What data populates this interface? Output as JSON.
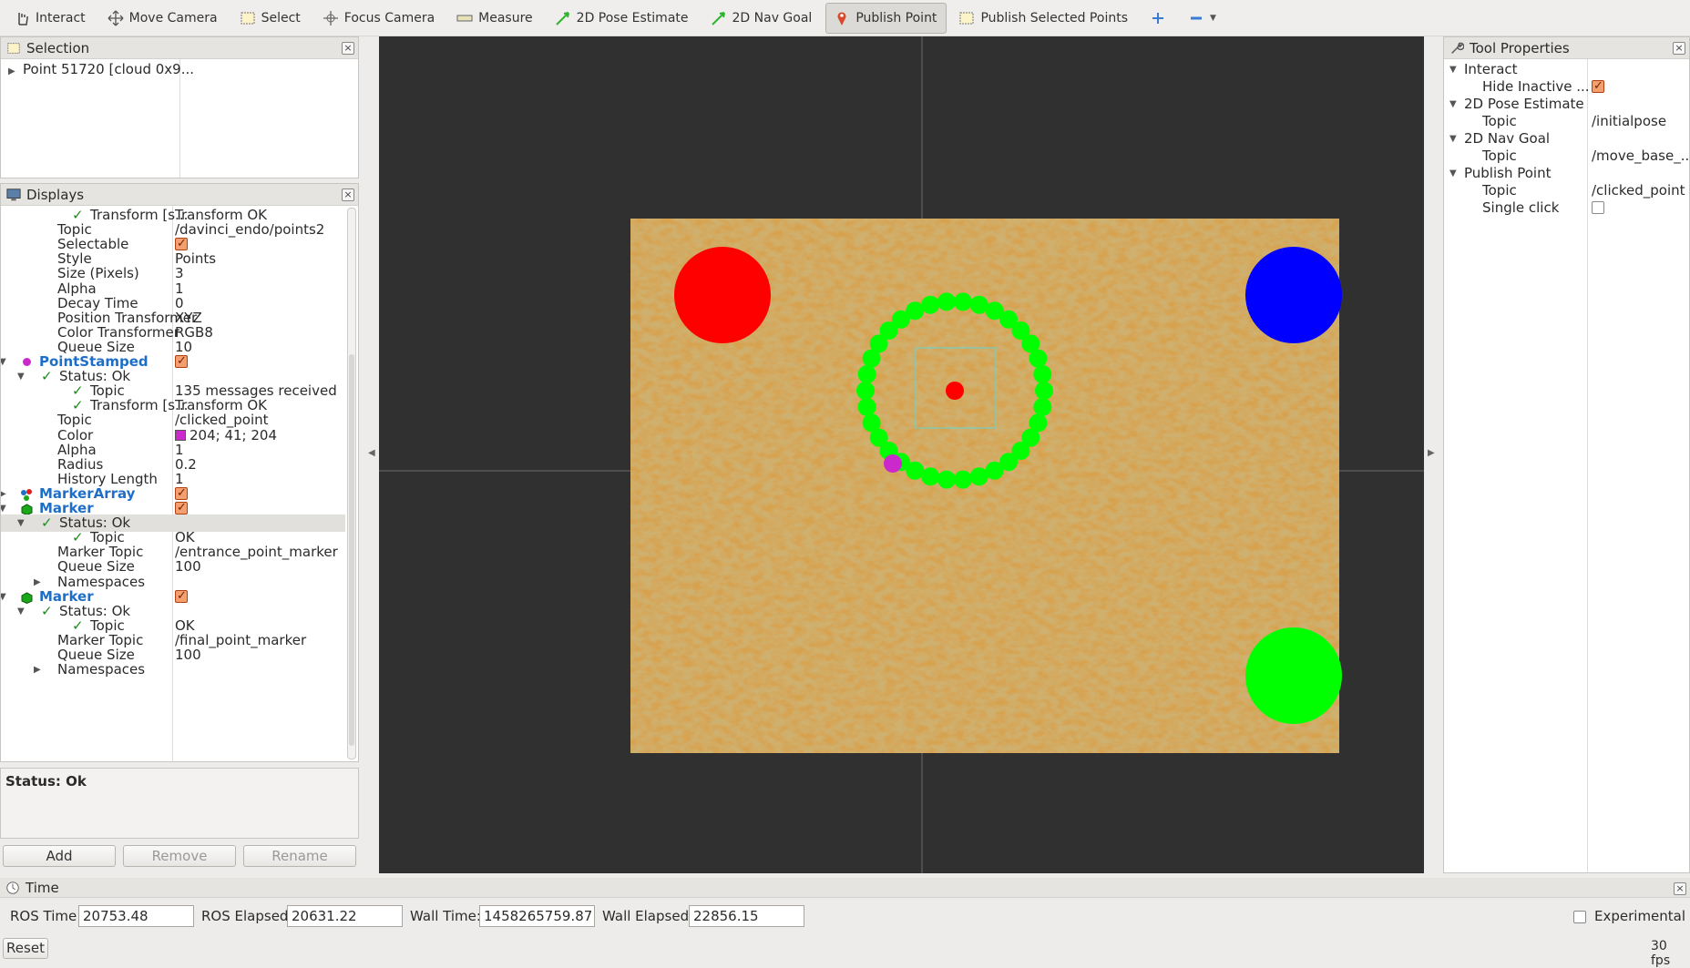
{
  "toolbar": {
    "tools": [
      {
        "label": "Interact",
        "icon": "hand-icon"
      },
      {
        "label": "Move Camera",
        "icon": "move-icon"
      },
      {
        "label": "Select",
        "icon": "select-icon"
      },
      {
        "label": "Focus Camera",
        "icon": "focus-icon"
      },
      {
        "label": "Measure",
        "icon": "ruler-icon"
      },
      {
        "label": "2D Pose Estimate",
        "icon": "arrow-green-icon"
      },
      {
        "label": "2D Nav Goal",
        "icon": "arrow-green-icon"
      },
      {
        "label": "Publish Point",
        "icon": "pin-icon",
        "active": true
      },
      {
        "label": "Publish Selected Points",
        "icon": "select-icon"
      }
    ]
  },
  "selection": {
    "title": "Selection",
    "items": [
      "Point 51720 [cloud 0x9..."
    ]
  },
  "displays": {
    "title": "Displays",
    "rows": [
      {
        "name": "Transform [s...",
        "value": "Transform OK"
      },
      {
        "name": "Topic",
        "value": "/davinci_endo/points2"
      },
      {
        "name": "Selectable",
        "value": ""
      },
      {
        "name": "Style",
        "value": "Points"
      },
      {
        "name": "Size (Pixels)",
        "value": "3"
      },
      {
        "name": "Alpha",
        "value": "1"
      },
      {
        "name": "Decay Time",
        "value": "0"
      },
      {
        "name": "Position Transformer",
        "value": "XYZ"
      },
      {
        "name": "Color Transformer",
        "value": "RGB8"
      },
      {
        "name": "Queue Size",
        "value": "10"
      },
      {
        "name": "PointStamped",
        "value": ""
      },
      {
        "name": "Status: Ok",
        "value": ""
      },
      {
        "name": "Topic",
        "value": "135 messages received"
      },
      {
        "name": "Transform [s...",
        "value": "Transform OK"
      },
      {
        "name": "Topic",
        "value": "/clicked_point"
      },
      {
        "name": "Color",
        "value": "204; 41; 204"
      },
      {
        "name": "Alpha",
        "value": "1"
      },
      {
        "name": "Radius",
        "value": "0.2"
      },
      {
        "name": "History Length",
        "value": "1"
      },
      {
        "name": "MarkerArray",
        "value": ""
      },
      {
        "name": "Marker",
        "value": ""
      },
      {
        "name": "Status: Ok",
        "value": ""
      },
      {
        "name": "Topic",
        "value": "OK"
      },
      {
        "name": "Marker Topic",
        "value": "/entrance_point_marker"
      },
      {
        "name": "Queue Size",
        "value": "100"
      },
      {
        "name": "Namespaces",
        "value": ""
      },
      {
        "name": "Marker",
        "value": ""
      },
      {
        "name": "Status: Ok",
        "value": ""
      },
      {
        "name": "Topic",
        "value": "OK"
      },
      {
        "name": "Marker Topic",
        "value": "/final_point_marker"
      },
      {
        "name": "Queue Size",
        "value": "100"
      },
      {
        "name": "Namespaces",
        "value": ""
      }
    ],
    "status_text": "Status: Ok",
    "buttons": {
      "add": "Add",
      "remove": "Remove",
      "rename": "Rename"
    }
  },
  "tool_properties": {
    "title": "Tool Properties",
    "rows": [
      {
        "name": "Interact",
        "value": ""
      },
      {
        "name": "Hide Inactive ...",
        "value": ""
      },
      {
        "name": "2D Pose Estimate",
        "value": ""
      },
      {
        "name": "Topic",
        "value": "/initialpose"
      },
      {
        "name": "2D Nav Goal",
        "value": ""
      },
      {
        "name": "Topic",
        "value": "/move_base_..."
      },
      {
        "name": "Publish Point",
        "value": ""
      },
      {
        "name": "Topic",
        "value": "/clicked_point"
      },
      {
        "name": "Single click",
        "value": ""
      }
    ]
  },
  "time": {
    "title": "Time",
    "ros_time_label": "ROS Time:",
    "ros_time": "20753.48",
    "ros_elapsed_label": "ROS Elapsed:",
    "ros_elapsed": "20631.22",
    "wall_time_label": "Wall Time:",
    "wall_time": "1458265759.87",
    "wall_elapsed_label": "Wall Elapsed:",
    "wall_elapsed": "22856.15",
    "experimental_label": "Experimental",
    "reset": "Reset",
    "fps": "30 fps"
  },
  "colors": {
    "point_color": "#cc29cc",
    "accent_blue": "#1e6ec8"
  }
}
